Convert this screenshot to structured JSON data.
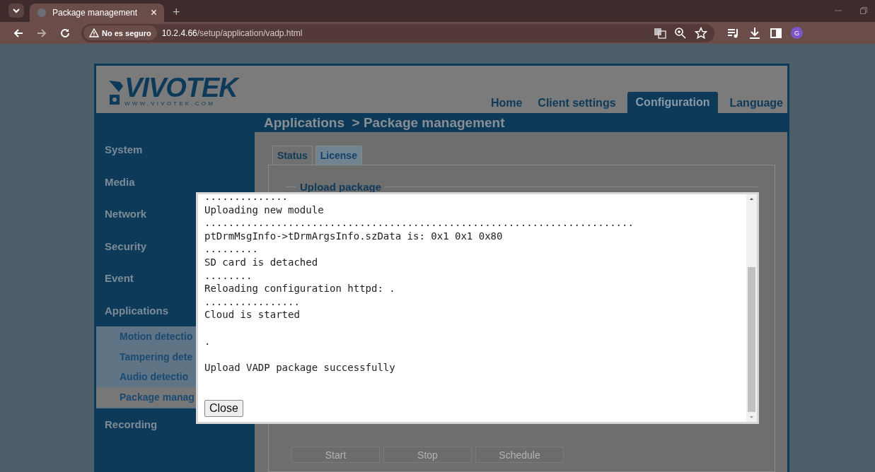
{
  "browser": {
    "tab_title": "Package management",
    "new_tab": "+",
    "security": "No es seguro",
    "url_host": "10.2.4.66",
    "url_path": "/setup/application/vadp.html",
    "avatar": "G",
    "tab_close": "×"
  },
  "logo": {
    "brand": "VIVOTEK",
    "site": "WWW.VIVOTEK.COM"
  },
  "header": {
    "nav": [
      {
        "label": "Home",
        "selected": false
      },
      {
        "label": "Client settings",
        "selected": false
      },
      {
        "label": "Configuration",
        "selected": true
      },
      {
        "label": "Language",
        "selected": false
      }
    ],
    "breadcrumb": "Applications  > Package management"
  },
  "sidebar": {
    "items": [
      {
        "label": "System"
      },
      {
        "label": "Media"
      },
      {
        "label": "Network"
      },
      {
        "label": "Security"
      },
      {
        "label": "Event"
      },
      {
        "label": "Applications",
        "children": [
          {
            "label": "Motion detectio",
            "selected": false
          },
          {
            "label": "Tampering dete",
            "selected": false
          },
          {
            "label": "Audio detectio",
            "selected": false
          },
          {
            "label": "Package manag",
            "selected": true
          }
        ]
      },
      {
        "label": "Recording"
      }
    ]
  },
  "content": {
    "tabs": [
      {
        "label": "Status",
        "selected": true
      },
      {
        "label": "License",
        "selected": false
      }
    ],
    "legend": "Upload package",
    "buttons": [
      {
        "label": "Start",
        "disabled": true
      },
      {
        "label": "Stop",
        "disabled": true
      },
      {
        "label": "Schedule",
        "disabled": true
      }
    ]
  },
  "dialog": {
    "log": [
      {
        "text": "..............",
        "spaced": false
      },
      {
        "text": "Uploading new module",
        "spaced": false
      },
      {
        "text": "........................................................................",
        "spaced": false
      },
      {
        "text": "ptDrmMsgInfo->tDrmArgsInfo.szData is: 0x1 0x1 0x80",
        "spaced": false
      },
      {
        "text": ".........",
        "spaced": false
      },
      {
        "text": "SD card is detached",
        "spaced": false
      },
      {
        "text": "........",
        "spaced": false
      },
      {
        "text": "Reloading configuration httpd: .",
        "spaced": false
      },
      {
        "text": "................",
        "spaced": false
      },
      {
        "text": "Cloud is started",
        "spaced": false
      },
      {
        "text": ".",
        "spaced": true
      },
      {
        "text": "Upload VADP package successfully",
        "spaced": true
      }
    ],
    "close_button": "Close"
  }
}
